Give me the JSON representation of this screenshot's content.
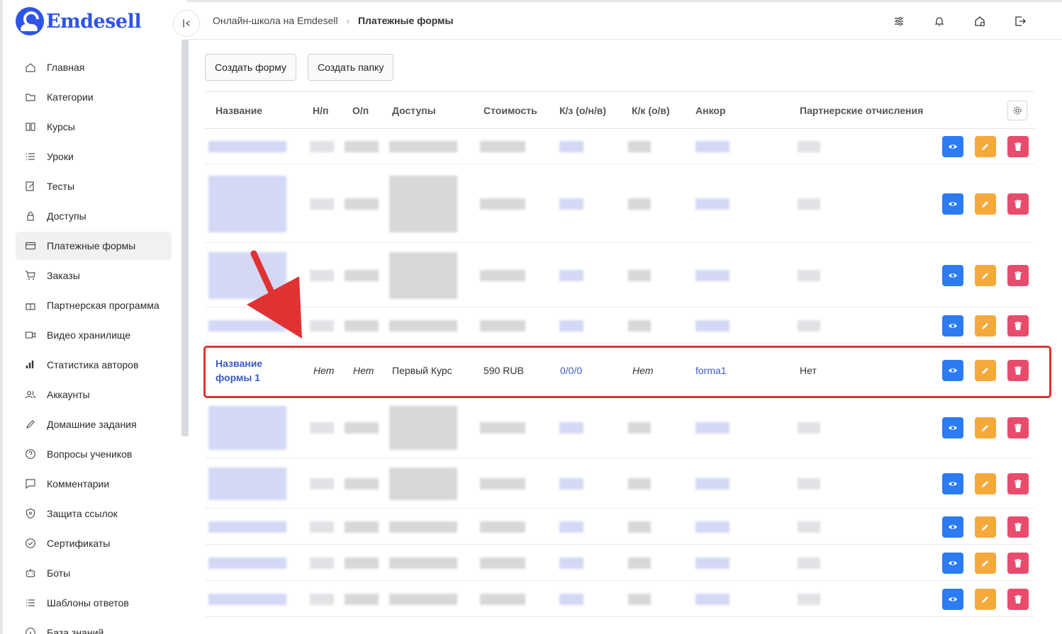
{
  "app": {
    "logo_text": "Emdesell"
  },
  "sidebar": {
    "items": [
      {
        "label": "Главная",
        "icon": "home-icon"
      },
      {
        "label": "Категории",
        "icon": "folder-icon"
      },
      {
        "label": "Курсы",
        "icon": "book-icon"
      },
      {
        "label": "Уроки",
        "icon": "list-icon"
      },
      {
        "label": "Тесты",
        "icon": "edit-icon"
      },
      {
        "label": "Доступы",
        "icon": "lock-icon"
      },
      {
        "label": "Платежные формы",
        "icon": "credit-card-icon",
        "active": true
      },
      {
        "label": "Заказы",
        "icon": "cart-icon"
      },
      {
        "label": "Партнерская программа",
        "icon": "gift-icon"
      },
      {
        "label": "Видео хранилище",
        "icon": "video-icon"
      },
      {
        "label": "Статистика авторов",
        "icon": "bar-chart-icon"
      },
      {
        "label": "Аккаунты",
        "icon": "users-icon"
      },
      {
        "label": "Домашние задания",
        "icon": "pen-icon"
      },
      {
        "label": "Вопросы учеников",
        "icon": "question-icon"
      },
      {
        "label": "Комментарии",
        "icon": "comment-icon"
      },
      {
        "label": "Защита ссылок",
        "icon": "shield-icon"
      },
      {
        "label": "Сертификаты",
        "icon": "check-circle-icon"
      },
      {
        "label": "Боты",
        "icon": "bot-icon"
      },
      {
        "label": "Шаблоны ответов",
        "icon": "list-icon"
      },
      {
        "label": "База знаний",
        "icon": "info-icon"
      }
    ]
  },
  "header": {
    "breadcrumb_link": "Онлайн-школа на Emdesell",
    "breadcrumb_current": "Платежные формы"
  },
  "toolbar": {
    "create_form": "Создать форму",
    "create_folder": "Создать папку"
  },
  "table": {
    "columns": [
      "Название",
      "Н/п",
      "О/п",
      "Доступы",
      "Стоимость",
      "К/з (о/н/в)",
      "К/к (о/в)",
      "Анкор",
      "Партнерские отчисления"
    ],
    "highlighted_row": {
      "name": "Название формы 1",
      "np": "Нет",
      "op": "Нет",
      "access": "Первый Курс",
      "price": "590 RUB",
      "kz": "0/0/0",
      "kk": "Нет",
      "anchor": "forma1",
      "partner": "Нет"
    }
  },
  "colors": {
    "accent": "#2f54e6",
    "view_button": "#2d7bf0",
    "edit_button": "#f6a93b",
    "delete_button": "#e84c6d",
    "highlight": "#e03232"
  }
}
